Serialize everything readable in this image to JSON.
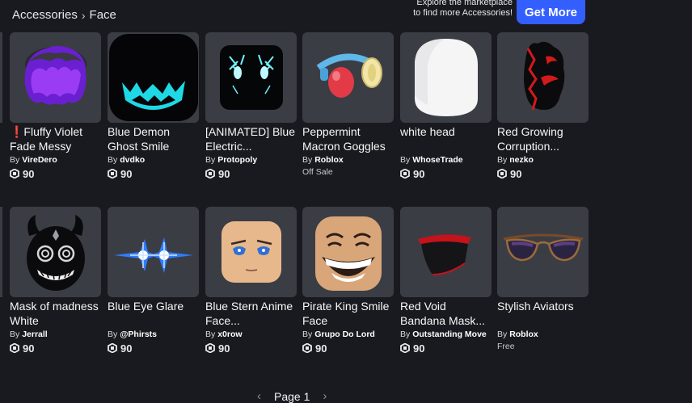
{
  "breadcrumb": {
    "parent": "Accessories",
    "current": "Face"
  },
  "promo": {
    "line1": "Explore the marketplace",
    "line2": "to find more Accessories!",
    "button": "Get More"
  },
  "colors": {
    "accent": "#335fff",
    "card_bg": "#3b3d45",
    "page_bg": "#191a1f"
  },
  "items": [
    {
      "name": "❗Fluffy Violet Fade Messy",
      "by_prefix": "By",
      "creator": "VireDero",
      "price": "90",
      "icon": "fluffy-violet-hair-thumbnail"
    },
    {
      "name": "Blue Demon Ghost Smile",
      "by_prefix": "By",
      "creator": "dvdko",
      "price": "90",
      "icon": "blue-demon-ghost-smile-thumbnail"
    },
    {
      "name": "[ANIMATED] Blue Electric...",
      "by_prefix": "By",
      "creator": "Protopoly",
      "price": "90",
      "icon": "blue-electric-face-thumbnail"
    },
    {
      "name": "Peppermint Macron Goggles",
      "by_prefix": "By",
      "creator": "Roblox",
      "status": "Off Sale",
      "icon": "peppermint-goggles-thumbnail"
    },
    {
      "name": "white head",
      "by_prefix": "By",
      "creator": "WhoseTrade",
      "price": "90",
      "icon": "white-head-thumbnail"
    },
    {
      "name": "Red Growing Corruption...",
      "by_prefix": "By",
      "creator": "nezko",
      "price": "90",
      "icon": "red-corruption-thumbnail"
    },
    {
      "name": "Mask of madness White",
      "by_prefix": "By",
      "creator": "Jerrall",
      "price": "90",
      "icon": "mask-of-madness-thumbnail"
    },
    {
      "name": "Blue Eye Glare",
      "by_prefix": "By",
      "creator": "@Phirsts",
      "price": "90",
      "icon": "blue-eye-glare-thumbnail"
    },
    {
      "name": "Blue Stern Anime Face...",
      "by_prefix": "By",
      "creator": "x0row",
      "price": "90",
      "icon": "blue-stern-anime-face-thumbnail"
    },
    {
      "name": "Pirate King Smile Face",
      "by_prefix": "By",
      "creator": "Grupo Do Lord",
      "price": "90",
      "icon": "pirate-king-smile-thumbnail"
    },
    {
      "name": "Red Void Bandana Mask...",
      "by_prefix": "By",
      "creator": "Outstanding Move",
      "price": "90",
      "icon": "red-void-bandana-thumbnail"
    },
    {
      "name": "Stylish Aviators",
      "by_prefix": "By",
      "creator": "Roblox",
      "status": "Free",
      "icon": "stylish-aviators-thumbnail"
    }
  ],
  "pagination": {
    "label": "Page 1",
    "prev_icon": "chevron-left-icon",
    "next_icon": "chevron-right-icon"
  }
}
